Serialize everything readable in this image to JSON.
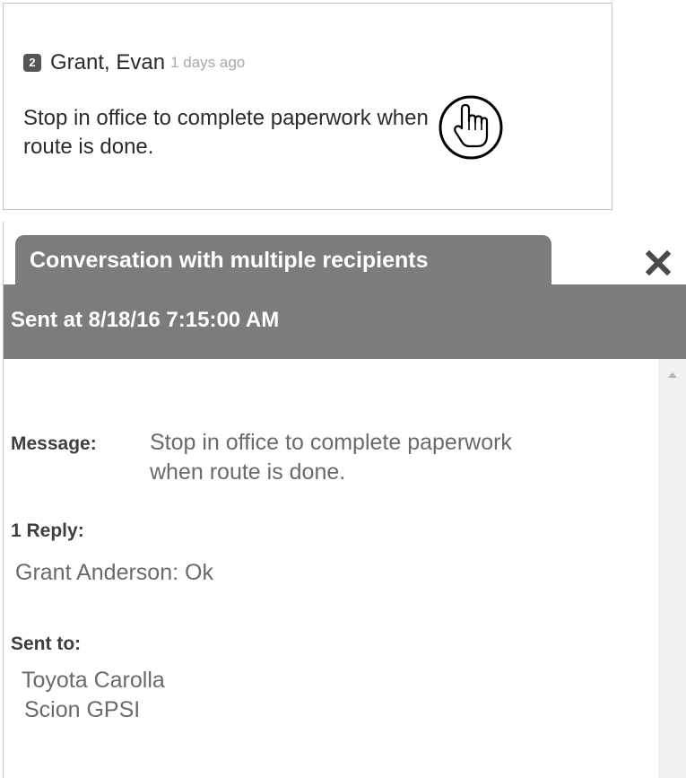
{
  "card": {
    "badge_count": "2",
    "sender": "Grant, Evan",
    "time_ago": "1 days ago",
    "message": "Stop in office to complete paperwork when route is done."
  },
  "panel": {
    "tab_title": "Conversation with multiple recipients",
    "sent_at": "Sent at 8/18/16 7:15:00 AM",
    "message_label": "Message:",
    "message_text": "Stop in office to complete paperwork when route is done.",
    "reply_label": "1 Reply:",
    "reply_text": "Grant Anderson: Ok",
    "sent_to_label": "Sent to:",
    "recipients": [
      "Toyota Carolla",
      "Scion GPSI"
    ]
  },
  "icons": {
    "cursor": "pointing-hand-cursor-icon",
    "close": "close-icon",
    "scroll_up": "chevron-up-icon"
  },
  "colors": {
    "header_gray": "#7c7c7c",
    "badge": "#555555",
    "muted_time": "#a8a8a8",
    "body_text": "#6a6a6a"
  }
}
